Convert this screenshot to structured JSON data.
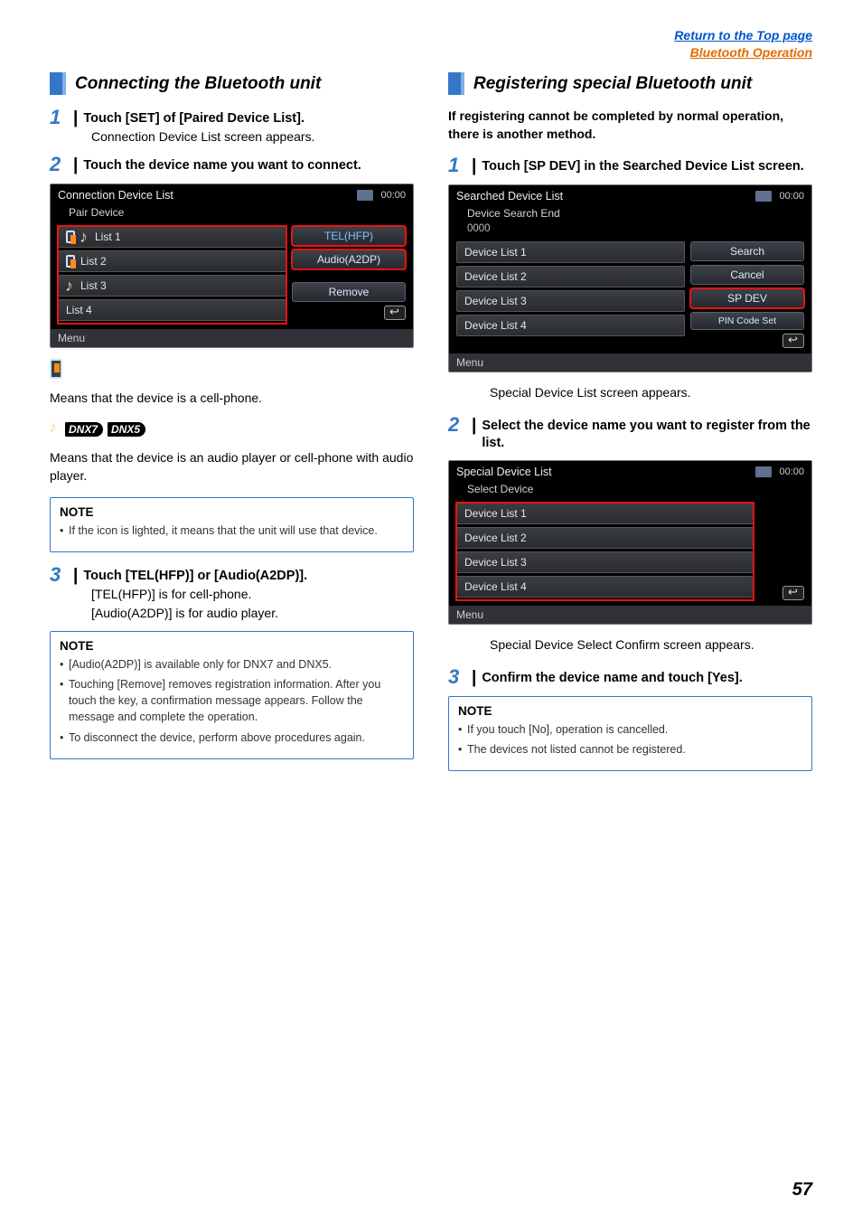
{
  "top_links": {
    "return": "Return to the Top page",
    "section": "Bluetooth Operation"
  },
  "left": {
    "heading": "Connecting the Bluetooth unit",
    "step1": {
      "num": "1",
      "title": "Touch [SET] of [Paired Device List].",
      "body": "Connection Device List screen appears."
    },
    "step2": {
      "num": "2",
      "title": "Touch the device name you want to connect."
    },
    "screenshot1": {
      "title": "Connection Device List",
      "clock": "00:00",
      "sub": "Pair Device",
      "items": [
        "List 1",
        "List 2",
        "List 3",
        "List 4"
      ],
      "btn_tel": "TEL(HFP)",
      "btn_audio": "Audio(A2DP)",
      "btn_remove": "Remove",
      "menu": "Menu"
    },
    "meaning_phone": "Means that the device is a cell-phone.",
    "model_dnx7": "DNX7",
    "model_dnx5": "DNX5",
    "meaning_audio": "Means that the device is an audio player or cell-phone with audio player.",
    "note1": {
      "title": "NOTE",
      "items": [
        "If the icon is lighted, it means that the unit will use that device."
      ]
    },
    "step3": {
      "num": "3",
      "title": "Touch [TEL(HFP)] or [Audio(A2DP)].",
      "line1": "[TEL(HFP)] is for cell-phone.",
      "line2": "[Audio(A2DP)] is for audio player."
    },
    "note2": {
      "title": "NOTE",
      "items": [
        "[Audio(A2DP)] is available only for DNX7 and DNX5.",
        "Touching [Remove] removes registration information. After you touch the key, a confirmation message appears. Follow the message and complete the operation.",
        "To disconnect the device, perform above procedures again."
      ]
    }
  },
  "right": {
    "heading": "Registering special Bluetooth unit",
    "intro": "If registering cannot be completed by normal operation, there is another method.",
    "step1": {
      "num": "1",
      "title": "Touch [SP DEV] in the Searched Device List screen."
    },
    "screenshot1": {
      "title": "Searched Device List",
      "clock": "00:00",
      "sub": "Device Search End",
      "fourzero": "0000",
      "items": [
        "Device List 1",
        "Device List 2",
        "Device List 3",
        "Device List 4"
      ],
      "btn_search": "Search",
      "btn_cancel": "Cancel",
      "btn_spdev": "SP DEV",
      "btn_pin": "PIN Code Set",
      "menu": "Menu"
    },
    "after_ss1": "Special Device List screen appears.",
    "step2": {
      "num": "2",
      "title": "Select the device name you want to register from the list."
    },
    "screenshot2": {
      "title": "Special Device List",
      "clock": "00:00",
      "sub": "Select Device",
      "items": [
        "Device List 1",
        "Device List 2",
        "Device List 3",
        "Device List 4"
      ],
      "menu": "Menu"
    },
    "after_ss2": "Special Device Select Confirm screen appears.",
    "step3": {
      "num": "3",
      "title": "Confirm the device name and touch [Yes]."
    },
    "note": {
      "title": "NOTE",
      "items": [
        "If you touch [No], operation is cancelled.",
        "The devices not listed cannot be registered."
      ]
    }
  },
  "page_number": "57"
}
